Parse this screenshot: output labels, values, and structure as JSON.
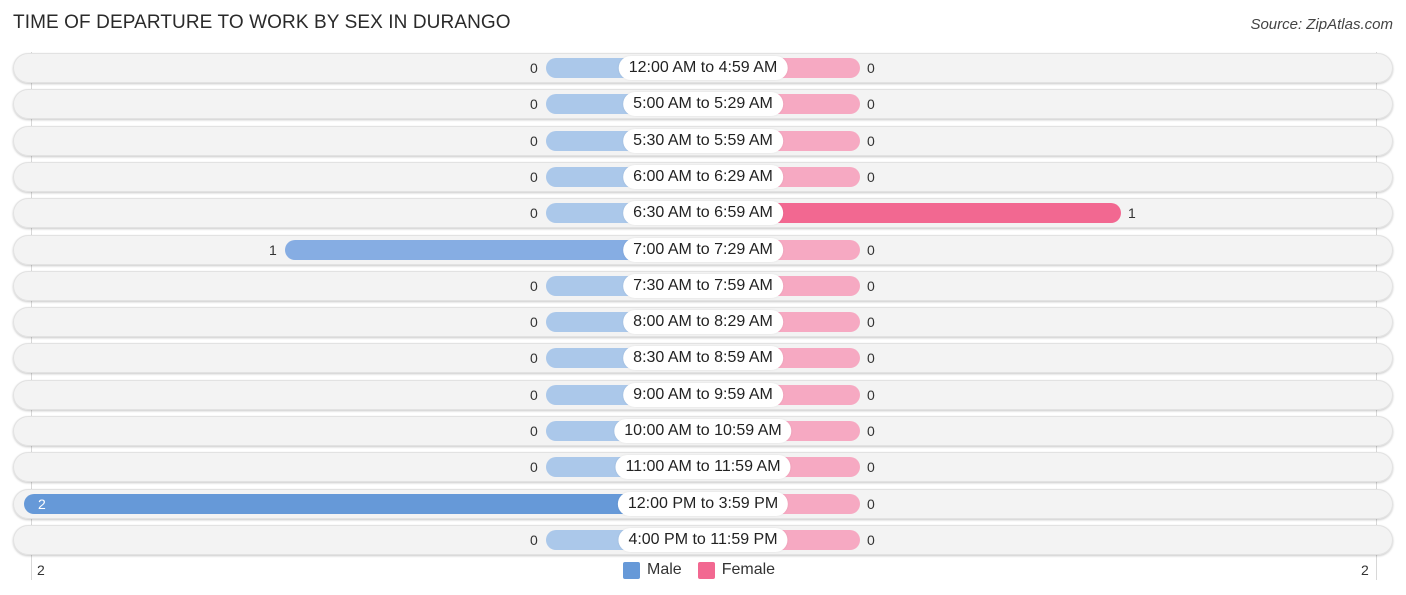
{
  "header": {
    "title": "TIME OF DEPARTURE TO WORK BY SEX IN DURANGO",
    "source": "Source: ZipAtlas.com"
  },
  "colors": {
    "male": "#6699d8",
    "male_light": "#abc8ea",
    "female": "#f26891",
    "female_light": "#f6a9c2"
  },
  "chart_data": {
    "type": "bar",
    "orientation": "horizontal-diverging",
    "title": "TIME OF DEPARTURE TO WORK BY SEX IN DURANGO",
    "categories": [
      "12:00 AM to 4:59 AM",
      "5:00 AM to 5:29 AM",
      "5:30 AM to 5:59 AM",
      "6:00 AM to 6:29 AM",
      "6:30 AM to 6:59 AM",
      "7:00 AM to 7:29 AM",
      "7:30 AM to 7:59 AM",
      "8:00 AM to 8:29 AM",
      "8:30 AM to 8:59 AM",
      "9:00 AM to 9:59 AM",
      "10:00 AM to 10:59 AM",
      "11:00 AM to 11:59 AM",
      "12:00 PM to 3:59 PM",
      "4:00 PM to 11:59 PM"
    ],
    "series": [
      {
        "name": "Male",
        "values": [
          0,
          0,
          0,
          0,
          0,
          1,
          0,
          0,
          0,
          0,
          0,
          0,
          2,
          0
        ]
      },
      {
        "name": "Female",
        "values": [
          0,
          0,
          0,
          0,
          1,
          0,
          0,
          0,
          0,
          0,
          0,
          0,
          0,
          0
        ]
      }
    ],
    "axis": {
      "left_tick": "2",
      "right_tick": "2",
      "max": 2
    },
    "legend": {
      "placement": "bottom-center",
      "entries": [
        "Male",
        "Female"
      ]
    }
  }
}
